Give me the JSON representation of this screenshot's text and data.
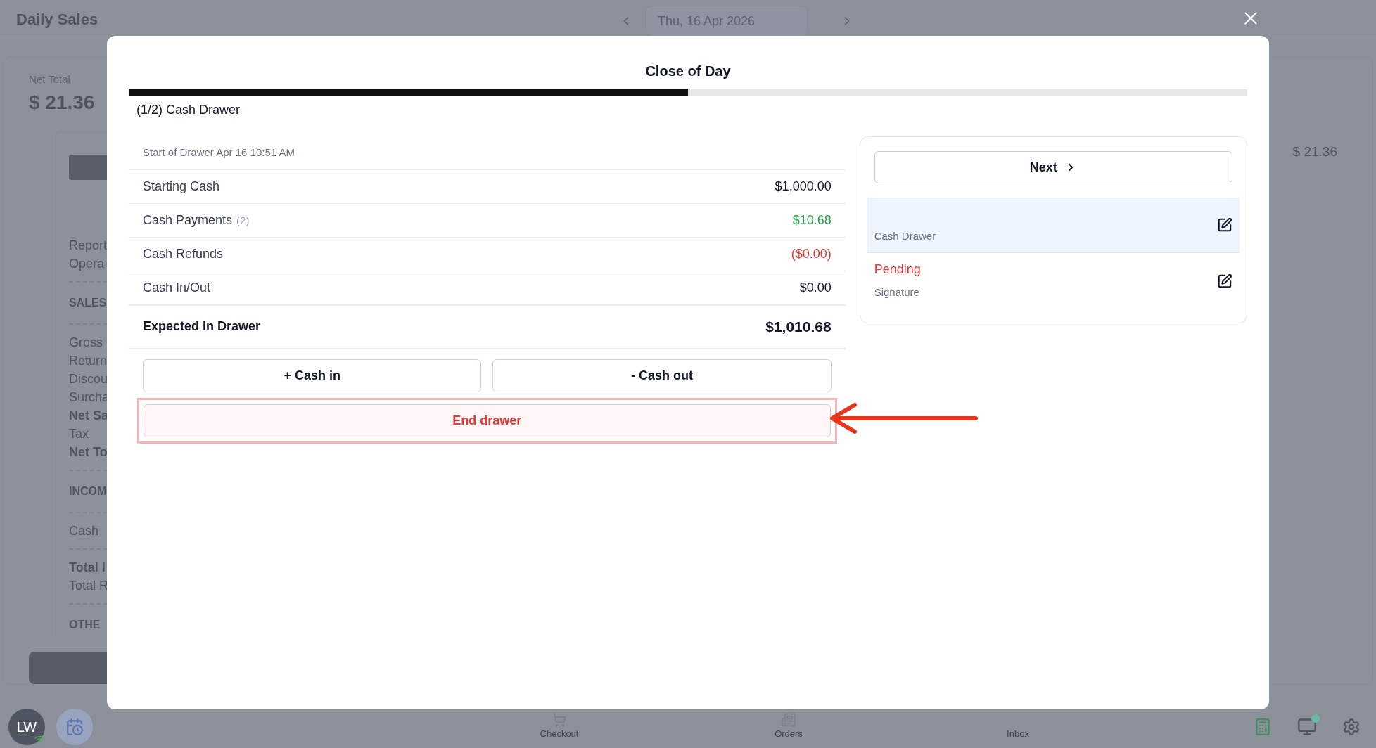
{
  "app": {
    "title": "Daily Sales",
    "date": "Thu, 16 Apr 2026"
  },
  "summary": {
    "label": "Net Total",
    "value": "$ 21.36",
    "side_value": "$ 21.36"
  },
  "report_lines": [
    {
      "kind": "text",
      "text": "Report"
    },
    {
      "kind": "text",
      "text": "Opera"
    },
    {
      "kind": "divider"
    },
    {
      "kind": "heading",
      "text": "SALES"
    },
    {
      "kind": "divider"
    },
    {
      "kind": "text",
      "text": "Gross"
    },
    {
      "kind": "text",
      "text": "Return"
    },
    {
      "kind": "text",
      "text": "Discou"
    },
    {
      "kind": "text",
      "text": "Surcha"
    },
    {
      "kind": "bold",
      "text": "Net Sa"
    },
    {
      "kind": "text",
      "text": "Tax"
    },
    {
      "kind": "bold",
      "text": "Net To"
    },
    {
      "kind": "divider"
    },
    {
      "kind": "heading",
      "text": "INCOM"
    },
    {
      "kind": "divider"
    },
    {
      "kind": "text",
      "text": "Cash"
    },
    {
      "kind": "divider"
    },
    {
      "kind": "bold",
      "text": "Total I"
    },
    {
      "kind": "text",
      "text": "Total R"
    },
    {
      "kind": "divider"
    },
    {
      "kind": "heading",
      "text": "OTHE"
    }
  ],
  "modal": {
    "title": "Close of Day",
    "progress": {
      "level": 0.5
    },
    "step_label": "(1/2) Cash Drawer",
    "drawer_start": "Start of Drawer Apr 16 10:51 AM",
    "rows": [
      {
        "label": "Starting Cash",
        "value": "$1,000.00",
        "color": "#111827"
      },
      {
        "label": "Cash Payments",
        "count": "(2)",
        "value": "$10.68",
        "color": "#22a447"
      },
      {
        "label": "Cash Refunds",
        "value": "($0.00)",
        "color": "#e53935"
      },
      {
        "label": "Cash In/Out",
        "value": "$0.00",
        "color": "#111827"
      }
    ],
    "expected": {
      "label": "Expected in Drawer",
      "value": "$1,010.68"
    },
    "actions": [
      "+ Cash in",
      "- Cash out"
    ],
    "end_button": {
      "label": "End drawer",
      "highlighted": true
    },
    "next_button": "Next",
    "steps": [
      {
        "name": "Cash Drawer",
        "selected": true
      },
      {
        "status": "Pending",
        "name": "Signature",
        "selected": false
      }
    ]
  },
  "bottom_nav": {
    "user_initials": "LW",
    "items": [
      {
        "kind": "cart",
        "label": "Checkout"
      },
      {
        "kind": "list",
        "label": "Orders"
      },
      {
        "kind": "none",
        "label": "Inbox"
      }
    ]
  }
}
